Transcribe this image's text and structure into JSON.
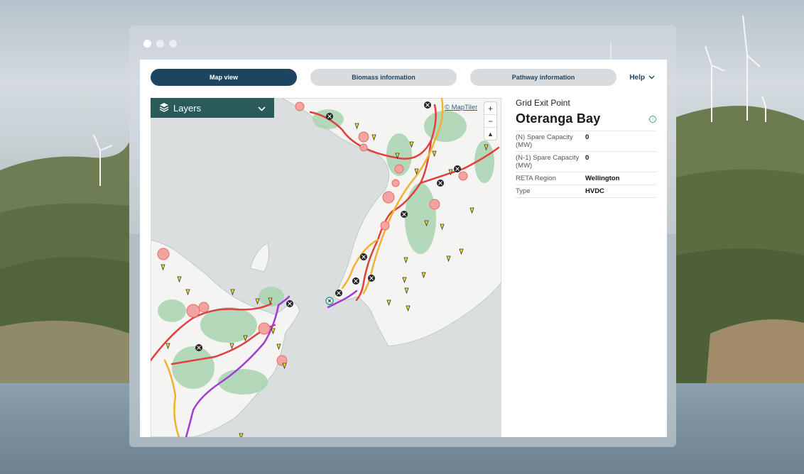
{
  "nav": {
    "tabs": [
      {
        "label": "Map view",
        "active": true
      },
      {
        "label": "Biomass information",
        "active": false
      },
      {
        "label": "Pathway information",
        "active": false
      }
    ],
    "help_label": "Help"
  },
  "map": {
    "layers_label": "Layers",
    "attribution": "© MapTiler",
    "zoom_in": "+",
    "zoom_out": "−",
    "compass": "▲"
  },
  "panel": {
    "subtitle": "Grid Exit Point",
    "title": "Oteranga Bay",
    "properties": [
      {
        "key": "(N) Spare Capacity (MW)",
        "value": "0"
      },
      {
        "key": "(N-1) Spare Capacity (MW)",
        "value": "0"
      },
      {
        "key": "RETA Region",
        "value": "Wellington"
      },
      {
        "key": "Type",
        "value": "HVDC"
      }
    ]
  },
  "colors": {
    "primary": "#1d4460",
    "layers_bg": "#2a5a5a",
    "line_red": "#e0403d",
    "line_orange": "#f0b12e",
    "line_purple": "#a23ad6",
    "marker_yellow": "#f3e323"
  }
}
